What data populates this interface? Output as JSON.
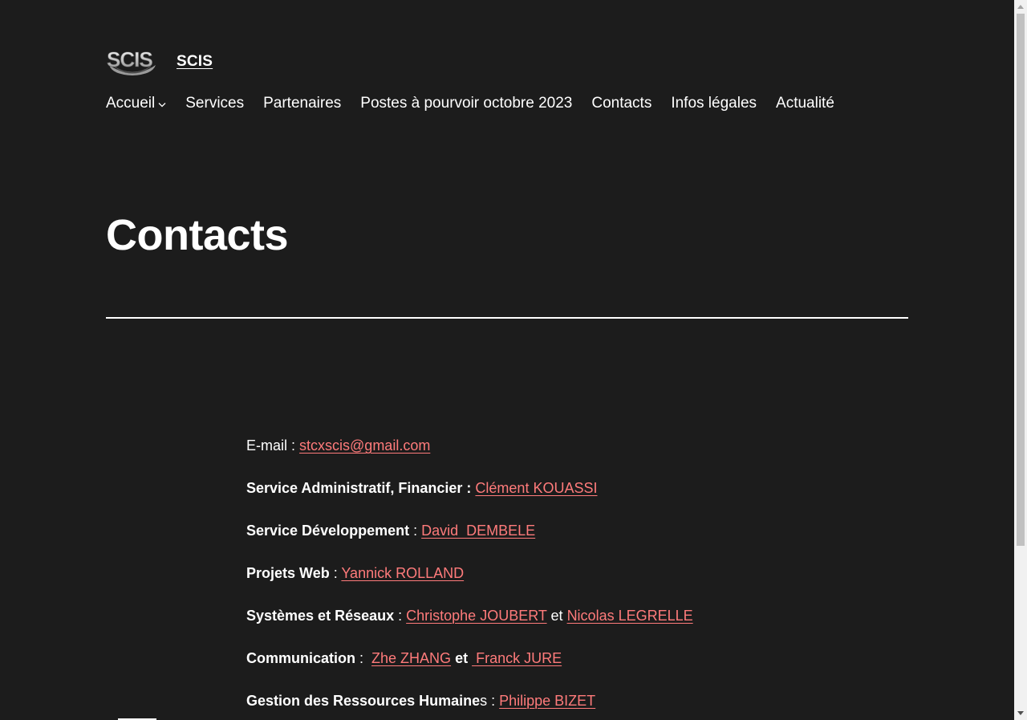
{
  "site": {
    "logo_text": "SCIS",
    "title": "SCIS"
  },
  "nav": {
    "items": [
      {
        "label": "Accueil",
        "has_submenu": true
      },
      {
        "label": "Services"
      },
      {
        "label": "Partenaires"
      },
      {
        "label": "Postes à pourvoir octobre 2023"
      },
      {
        "label": "Contacts"
      },
      {
        "label": "Infos légales"
      },
      {
        "label": "Actualité"
      }
    ]
  },
  "page": {
    "title": "Contacts"
  },
  "contacts": {
    "email": {
      "label": "E-mail :",
      "value": "stcxscis@gmail.com"
    },
    "admin": {
      "label": "Service Administratif, Financier",
      "sep": " : ",
      "person": "Clément KOUASSI"
    },
    "dev": {
      "label": "Service Développement",
      "sep": " : ",
      "person": "David  DEMBELE"
    },
    "web": {
      "label": "Projets Web",
      "sep": " : ",
      "person": "Yannick ROLLAND"
    },
    "sysnet": {
      "label": "Systèmes et Réseaux",
      "sep": " : ",
      "person1": "Christophe JOUBERT",
      "conj": " et ",
      "person2": "Nicolas LEGRELLE"
    },
    "comm": {
      "label": "Communication",
      "sep": " :  ",
      "person1": "Zhe ZHANG",
      "conj": " et ",
      "person2": " Franck JURE"
    },
    "hr": {
      "label": "Gestion des Ressources Humaine",
      "label_tail": "s",
      "sep": " : ",
      "person": "Philippe BIZET"
    }
  },
  "colors": {
    "background": "#1c1c1c",
    "text": "#ffffff",
    "link": "#ff7b7b"
  }
}
